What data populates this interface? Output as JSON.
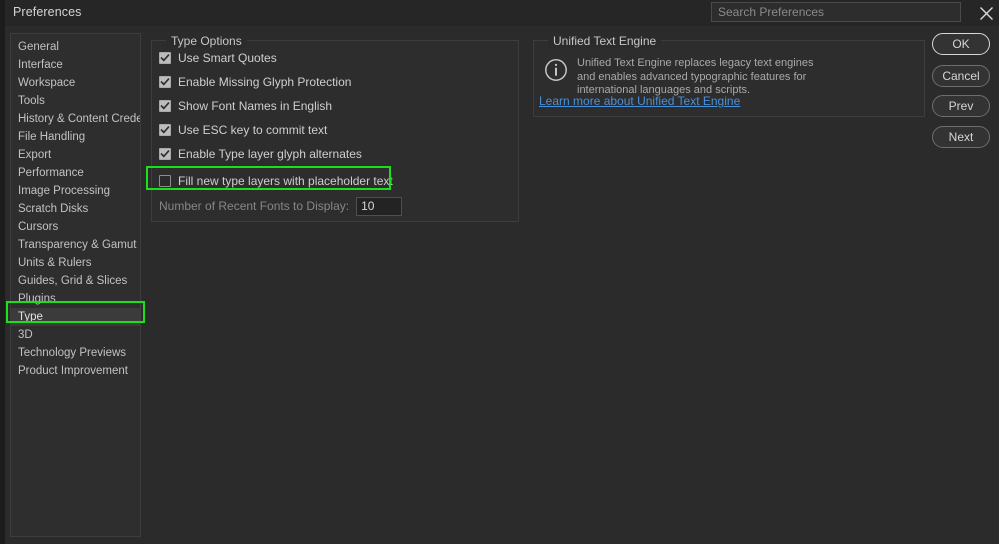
{
  "window": {
    "title": "Preferences",
    "close_icon": "close-icon"
  },
  "search": {
    "placeholder": "Search Preferences",
    "value": ""
  },
  "sidebar": {
    "items": [
      {
        "label": "General",
        "selected": false
      },
      {
        "label": "Interface",
        "selected": false
      },
      {
        "label": "Workspace",
        "selected": false
      },
      {
        "label": "Tools",
        "selected": false
      },
      {
        "label": "History & Content Credentials",
        "selected": false
      },
      {
        "label": "File Handling",
        "selected": false
      },
      {
        "label": "Export",
        "selected": false
      },
      {
        "label": "Performance",
        "selected": false
      },
      {
        "label": "Image Processing",
        "selected": false
      },
      {
        "label": "Scratch Disks",
        "selected": false
      },
      {
        "label": "Cursors",
        "selected": false
      },
      {
        "label": "Transparency & Gamut",
        "selected": false
      },
      {
        "label": "Units & Rulers",
        "selected": false
      },
      {
        "label": "Guides, Grid & Slices",
        "selected": false
      },
      {
        "label": "Plugins",
        "selected": false
      },
      {
        "label": "Type",
        "selected": true
      },
      {
        "label": "3D",
        "selected": false
      },
      {
        "label": "Technology Previews",
        "selected": false
      },
      {
        "label": "Product Improvement",
        "selected": false
      }
    ]
  },
  "type_options": {
    "title": "Type Options",
    "checkboxes": [
      {
        "label": "Use Smart Quotes",
        "checked": true
      },
      {
        "label": "Enable Missing Glyph Protection",
        "checked": true
      },
      {
        "label": "Show Font Names in English",
        "checked": true
      },
      {
        "label": "Use ESC key to commit text",
        "checked": true
      },
      {
        "label": "Enable Type layer glyph alternates",
        "checked": true
      },
      {
        "label": "Fill new type layers with placeholder text",
        "checked": false
      }
    ],
    "recent_fonts": {
      "label": "Number of Recent Fonts to Display:",
      "value": "10"
    }
  },
  "unified_text_engine": {
    "title": "Unified Text Engine",
    "info_icon": "info-circle-icon",
    "description": "Unified Text Engine replaces legacy text engines and enables advanced typographic features for international languages and scripts.",
    "link": "Learn more about Unified Text Engine"
  },
  "buttons": {
    "ok": "OK",
    "cancel": "Cancel",
    "prev": "Prev",
    "next": "Next"
  },
  "annotations": {
    "color": "#19e019",
    "highlighted": [
      "Type",
      "Fill new type layers with placeholder text"
    ]
  }
}
